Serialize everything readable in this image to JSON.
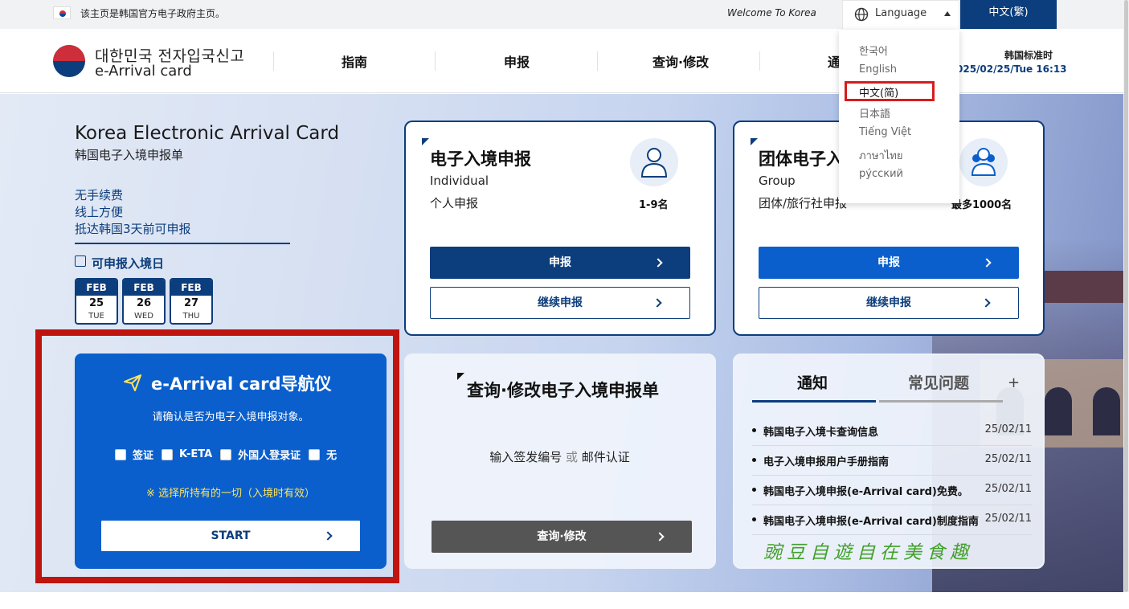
{
  "topbar": {
    "notice": "该主页是韩国官方电子政府主页。",
    "welcome": "Welcome To Korea",
    "language_label": "Language",
    "current_lang": "中文(繁)"
  },
  "header": {
    "logo_ko": "대한민국 전자입국신고",
    "logo_en": "e-Arrival card",
    "nav": [
      "指南",
      "申报",
      "查询·修改",
      "通"
    ],
    "time_label": "韩国标准时",
    "time_value": "025/02/25/Tue 16:13"
  },
  "intro": {
    "title": "Korea Electronic Arrival Card",
    "subtitle": "韩国电子入境申报单",
    "features": [
      "无手续费",
      "线上方便",
      "抵达韩国3天前可申报"
    ],
    "calendar_title": "可申报入境日",
    "dates": [
      {
        "month": "FEB",
        "day": "25",
        "weekday": "TUE"
      },
      {
        "month": "FEB",
        "day": "26",
        "weekday": "WED"
      },
      {
        "month": "FEB",
        "day": "27",
        "weekday": "THU"
      }
    ]
  },
  "navigator": {
    "title": "e-Arrival card导航仪",
    "question": "请确认是否为电子入境申报对象。",
    "options": [
      "签证",
      "K-ETA",
      "外国人登录证",
      "无"
    ],
    "note": "※ 选择所持有的一切（入境时有效）",
    "start_label": "START"
  },
  "individual": {
    "title": "电子入境申报",
    "en": "Individual",
    "zh": "个人申报",
    "count": "1-9名",
    "apply_label": "申报",
    "continue_label": "继续申报"
  },
  "group": {
    "title": "团体电子入",
    "en": "Group",
    "zh": "团体/旅行社申报",
    "count": "最多1000名",
    "apply_label": "申报",
    "continue_label": "继续申报"
  },
  "search": {
    "title": "查询·修改电子入境申报单",
    "desc_a": "输入签发编号",
    "desc_or": "或",
    "desc_b": "邮件认证",
    "button_label": "查询·修改"
  },
  "notices": {
    "tab_active": "通知",
    "tab_other": "常见问题",
    "more": "+",
    "items": [
      {
        "text": "韩国电子入境卡查询信息",
        "date": "25/02/11"
      },
      {
        "text": "电子入境申报用户手册指南",
        "date": "25/02/11"
      },
      {
        "text": "韩国电子入境申报(e-Arrival card)免费。",
        "date": "25/02/11"
      },
      {
        "text": "韩国电子入境申报(e-Arrival card)制度指南",
        "date": "25/02/11"
      }
    ]
  },
  "language_menu": {
    "items": [
      "한국어",
      "English",
      "中文(简)",
      "日本語",
      "Tiếng Việt",
      "ภาษาไทย",
      "рýсский"
    ],
    "selected": "中文(简)"
  },
  "watermark": "豌豆自遊自在美食趣",
  "colors": {
    "navy": "#0c3d7c",
    "blue": "#0a5fcc",
    "highlight": "#c0140f"
  }
}
